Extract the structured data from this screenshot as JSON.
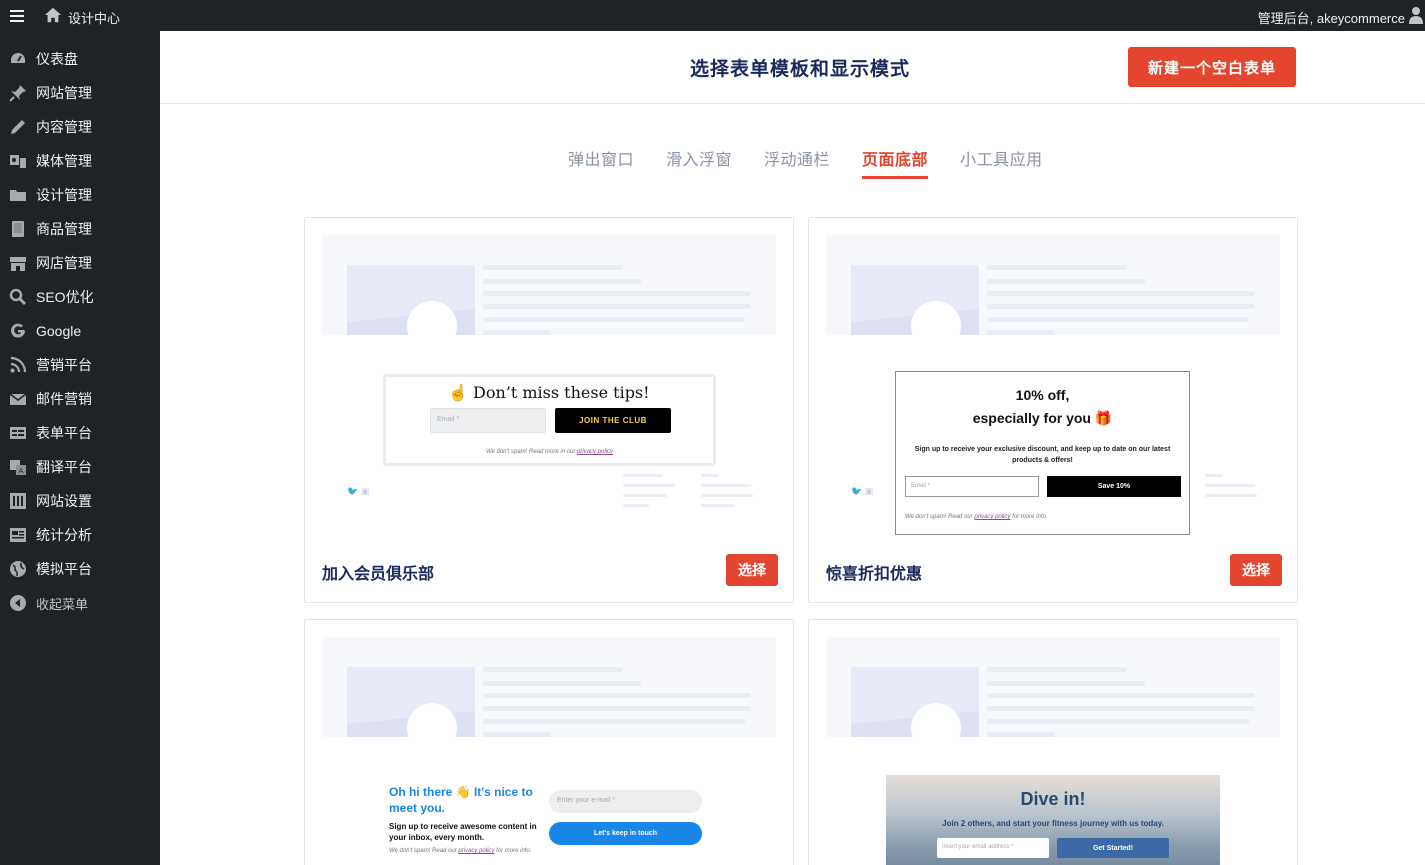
{
  "topbar": {
    "site_name": "设计中心",
    "account": "管理后台, akeycommerce"
  },
  "sidebar": {
    "items": [
      {
        "label": "仪表盘",
        "icon": "dashboard-icon"
      },
      {
        "label": "网站管理",
        "icon": "pin-icon"
      },
      {
        "label": "内容管理",
        "icon": "pencil-icon"
      },
      {
        "label": "媒体管理",
        "icon": "media-icon"
      },
      {
        "label": "设计管理",
        "icon": "folder-icon"
      },
      {
        "label": "商品管理",
        "icon": "book-icon"
      },
      {
        "label": "网店管理",
        "icon": "store-icon"
      },
      {
        "label": "SEO优化",
        "icon": "search-icon"
      },
      {
        "label": "Google",
        "icon": "google-icon"
      },
      {
        "label": "营销平台",
        "icon": "rss-icon"
      },
      {
        "label": "邮件营销",
        "icon": "mail-icon"
      },
      {
        "label": "表单平台",
        "icon": "form-icon"
      },
      {
        "label": "翻译平台",
        "icon": "translate-icon"
      },
      {
        "label": "网站设置",
        "icon": "settings-icon"
      },
      {
        "label": "统计分析",
        "icon": "chart-icon"
      },
      {
        "label": "模拟平台",
        "icon": "globe-icon"
      }
    ],
    "collapse_label": "收起菜单"
  },
  "header": {
    "title": "选择表单模板和显示模式",
    "new_button": "新建一个空白表单"
  },
  "tabs": [
    "弹出窗口",
    "滑入浮窗",
    "浮动通栏",
    "页面底部",
    "小工具应用"
  ],
  "active_tab": "页面底部",
  "cards": [
    {
      "title": "加入会员俱乐部",
      "select_label": "选择",
      "preview": {
        "heading": "☝ Don’t miss these tips!",
        "email_placeholder": "Email *",
        "button": "JOIN THE CLUB",
        "note": "We don't spam! Read more in our",
        "note_link": "privacy policy"
      }
    },
    {
      "title": "惊喜折扣优惠",
      "select_label": "选择",
      "preview": {
        "heading_line1": "10% off,",
        "heading_line2": "especially for you 🎁",
        "sub": "Sign up to receive your exclusive discount, and keep up to date on our latest products & offers!",
        "email_placeholder": "Email *",
        "button": "Save 10%",
        "note": "We don't spam! Read our",
        "note_link": "privacy policy",
        "note_end": "for more info."
      }
    },
    {
      "preview": {
        "heading": "Oh hi there 👋 It's nice to meet you.",
        "sub": "Sign up to receive awesome content in your inbox, every month.",
        "email_placeholder": "Enter your e-mail *",
        "button": "Let's keep in touch",
        "note": "We don't spam! Read our",
        "note_link": "privacy policy",
        "note_end": "for more info."
      }
    },
    {
      "preview": {
        "heading": "Dive in!",
        "sub": "Join 2 others, and start your fitness journey with us today.",
        "email_placeholder": "Insert your email address *",
        "button": "Get Started!"
      }
    }
  ],
  "colors": {
    "accent": "#e4452f",
    "sidebar_bg": "#1d2327",
    "title_navy": "#1a2a5c"
  }
}
